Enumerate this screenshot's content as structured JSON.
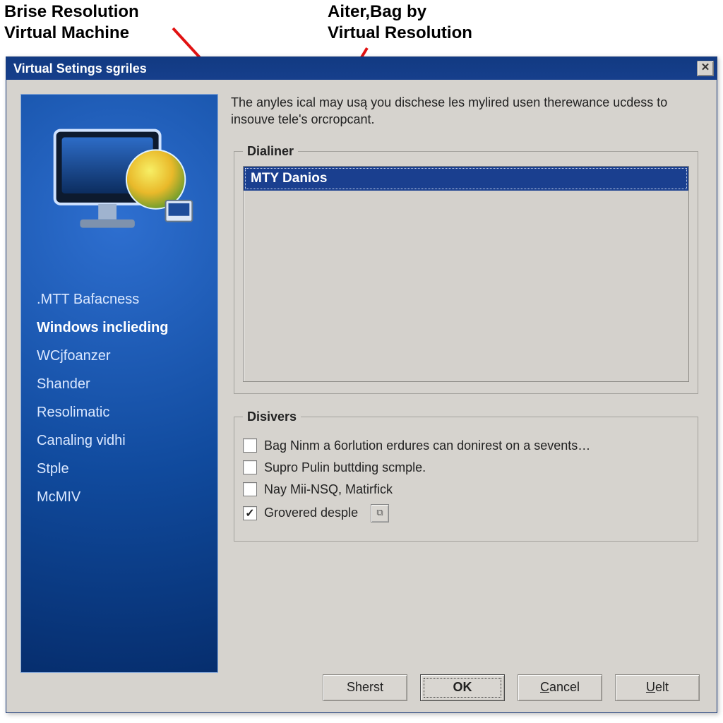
{
  "annotations": {
    "left_label_line1": "Brise Resolution",
    "left_label_line2": "Virtual Machine",
    "right_label_line1": "Aiter,Bag by",
    "right_label_line2": "Virtual Resolution"
  },
  "arrows": {
    "left": {
      "from": [
        245,
        40
      ],
      "to": [
        344,
        148
      ]
    },
    "right": {
      "from": [
        520,
        68
      ],
      "to": [
        470,
        150
      ]
    },
    "color": "#e11212"
  },
  "dialog": {
    "title": "Virtual Setings sgriles",
    "close_glyph": "✕"
  },
  "sidebar": {
    "icon_name": "monitor-globe-icon",
    "items": [
      {
        "label": ".MTT Bafacness",
        "active": false
      },
      {
        "label": "Windows inclieding",
        "active": true
      },
      {
        "label": "WCjfoanzer",
        "active": false
      },
      {
        "label": "Shander",
        "active": false
      },
      {
        "label": "Resolimatic",
        "active": false
      },
      {
        "label": "Canaling vidhi",
        "active": false
      },
      {
        "label": "Stple",
        "active": false
      },
      {
        "label": "McMIV",
        "active": false
      }
    ]
  },
  "main": {
    "description": "The anyles ical may usą you dischese les mylired usen therewance ucdess to insouve tele's orcropcant.",
    "group1": {
      "legend": "Dialiner",
      "items": [
        {
          "label": "MTY Danios",
          "selected": true
        }
      ]
    },
    "group2": {
      "legend": "Disivers",
      "checkboxes": [
        {
          "label": "Bag Ninm a 6orlution erdures can donirest on a sevents…",
          "checked": false
        },
        {
          "label": "Supro Pulin buttding scmple.",
          "checked": false
        },
        {
          "label": "Nay Mii-NSQ, Matirfick",
          "checked": false
        },
        {
          "label": "Grovered desple",
          "checked": true,
          "has_config_button": true
        }
      ]
    }
  },
  "buttons": {
    "sherst": "Sherst",
    "ok": "OK",
    "cancel_pre": "C",
    "cancel_post": "ancel",
    "uelt_pre": "U",
    "uelt_post": "elt"
  },
  "colors": {
    "titlebar": "#133c86",
    "selection": "#1a3f8f",
    "dialog_face": "#d6d3ce"
  }
}
